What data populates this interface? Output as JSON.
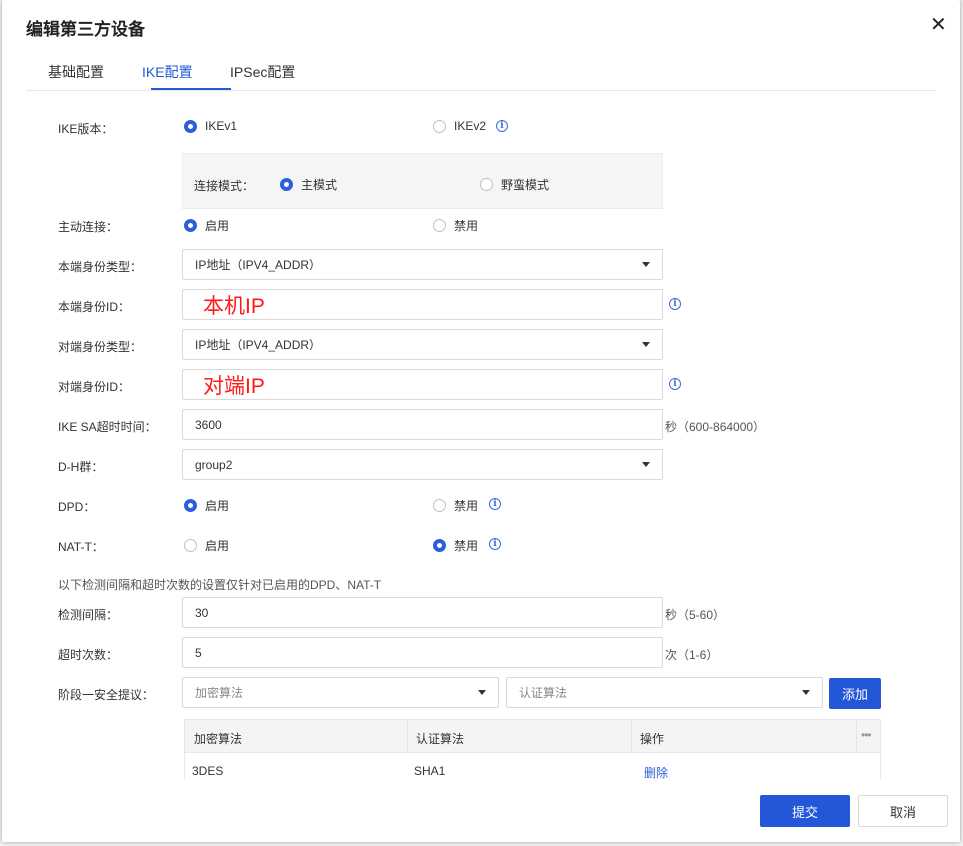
{
  "dialog": {
    "title": "编辑第三方设备",
    "close_icon": "close-icon"
  },
  "tabs": [
    {
      "label": "基础配置",
      "active": false
    },
    {
      "label": "IKE配置",
      "active": true
    },
    {
      "label": "IPSec配置",
      "active": false
    }
  ],
  "form": {
    "ike_version": {
      "label": "IKE版本：",
      "opt1": "IKEv1",
      "opt2": "IKEv2",
      "selected": "IKEv1"
    },
    "connect_mode": {
      "label": "连接模式：",
      "opt1": "主模式",
      "opt2": "野蛮模式",
      "selected": "主模式"
    },
    "active_connect": {
      "label": "主动连接：",
      "opt1": "启用",
      "opt2": "禁用",
      "selected": "启用"
    },
    "local_id_type": {
      "label": "本端身份类型：",
      "value": "IP地址（IPV4_ADDR）"
    },
    "local_id": {
      "label": "本端身份ID：",
      "value": "本机IP"
    },
    "peer_id_type": {
      "label": "对端身份类型：",
      "value": "IP地址（IPV4_ADDR）"
    },
    "peer_id": {
      "label": "对端身份ID：",
      "value": "对端IP"
    },
    "sa_timeout": {
      "label": "IKE SA超时时间：",
      "value": "3600",
      "unit": "秒（600-864000）"
    },
    "dh_group": {
      "label": "D-H群：",
      "value": "group2"
    },
    "dpd": {
      "label": "DPD：",
      "opt1": "启用",
      "opt2": "禁用",
      "selected": "启用"
    },
    "nat_t": {
      "label": "NAT-T：",
      "opt1": "启用",
      "opt2": "禁用",
      "selected": "禁用"
    },
    "note": "以下检测间隔和超时次数的设置仅针对已启用的DPD、NAT-T",
    "interval": {
      "label": "检测间隔：",
      "value": "30",
      "unit": "秒（5-60）"
    },
    "timeout_count": {
      "label": "超时次数：",
      "value": "5",
      "unit": "次（1-6）"
    },
    "phase1": {
      "label": "阶段一安全提议：",
      "enc_placeholder": "加密算法",
      "auth_placeholder": "认证算法",
      "add_label": "添加"
    }
  },
  "proposal_table": {
    "headers": [
      "加密算法",
      "认证算法",
      "操作"
    ],
    "rows": [
      {
        "enc": "3DES",
        "auth": "SHA1",
        "action": "删除"
      }
    ],
    "more_icon": "more-icon"
  },
  "footer": {
    "submit_label": "提交",
    "cancel_label": "取消"
  },
  "colors": {
    "accent": "#2456d8",
    "annotation_red": "#ff1a1a"
  }
}
